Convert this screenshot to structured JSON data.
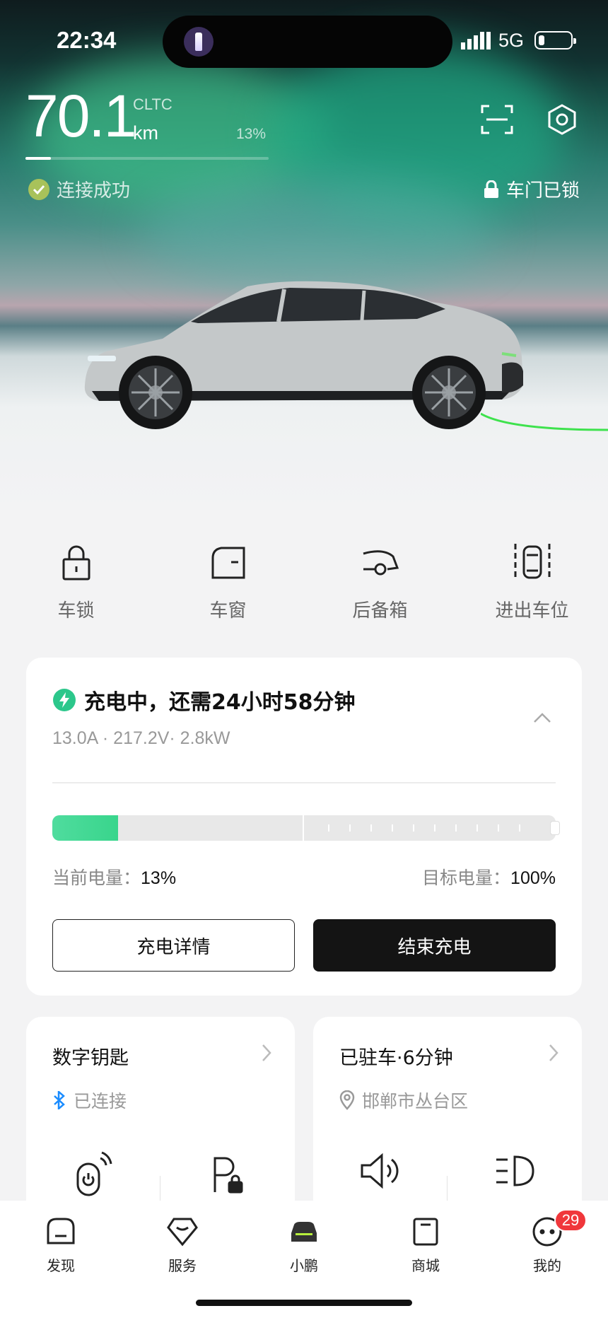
{
  "status_bar": {
    "time": "22:34",
    "network": "5G"
  },
  "vehicle": {
    "range_value": "70.1",
    "range_standard": "CLTC",
    "range_unit": "km",
    "battery_percent_label": "13%",
    "battery_fraction": 0.13,
    "connection_status": "连接成功",
    "door_status": "车门已锁"
  },
  "quick_actions": [
    {
      "label": "车锁",
      "icon": "lock-icon"
    },
    {
      "label": "车窗",
      "icon": "window-icon"
    },
    {
      "label": "后备箱",
      "icon": "trunk-icon"
    },
    {
      "label": "进出车位",
      "icon": "parking-move-icon"
    }
  ],
  "charging": {
    "title": "充电中，还需24小时58分钟",
    "stats": "13.0A · 217.2V· 2.8kW",
    "current_label": "当前电量：",
    "current_value": "13%",
    "current_fraction": 0.13,
    "target_label": "目标电量：",
    "target_value": "100%",
    "detail_button": "充电详情",
    "stop_button": "结束充电",
    "accent_color": "#2cc78b"
  },
  "digital_key": {
    "title": "数字钥匙",
    "status": "已连接",
    "actions": [
      "remote-start-icon",
      "parking-lock-icon"
    ]
  },
  "parking": {
    "title": "已驻车·6分钟",
    "location": "邯郸市丛台区",
    "actions": [
      "horn-icon",
      "headlight-icon"
    ]
  },
  "tab_bar": {
    "tabs": [
      {
        "label": "发现",
        "icon": "discover-icon"
      },
      {
        "label": "服务",
        "icon": "service-icon"
      },
      {
        "label": "小鹏",
        "icon": "car-icon"
      },
      {
        "label": "商城",
        "icon": "shop-icon"
      },
      {
        "label": "我的",
        "icon": "profile-icon"
      }
    ],
    "badge_count": "29"
  }
}
